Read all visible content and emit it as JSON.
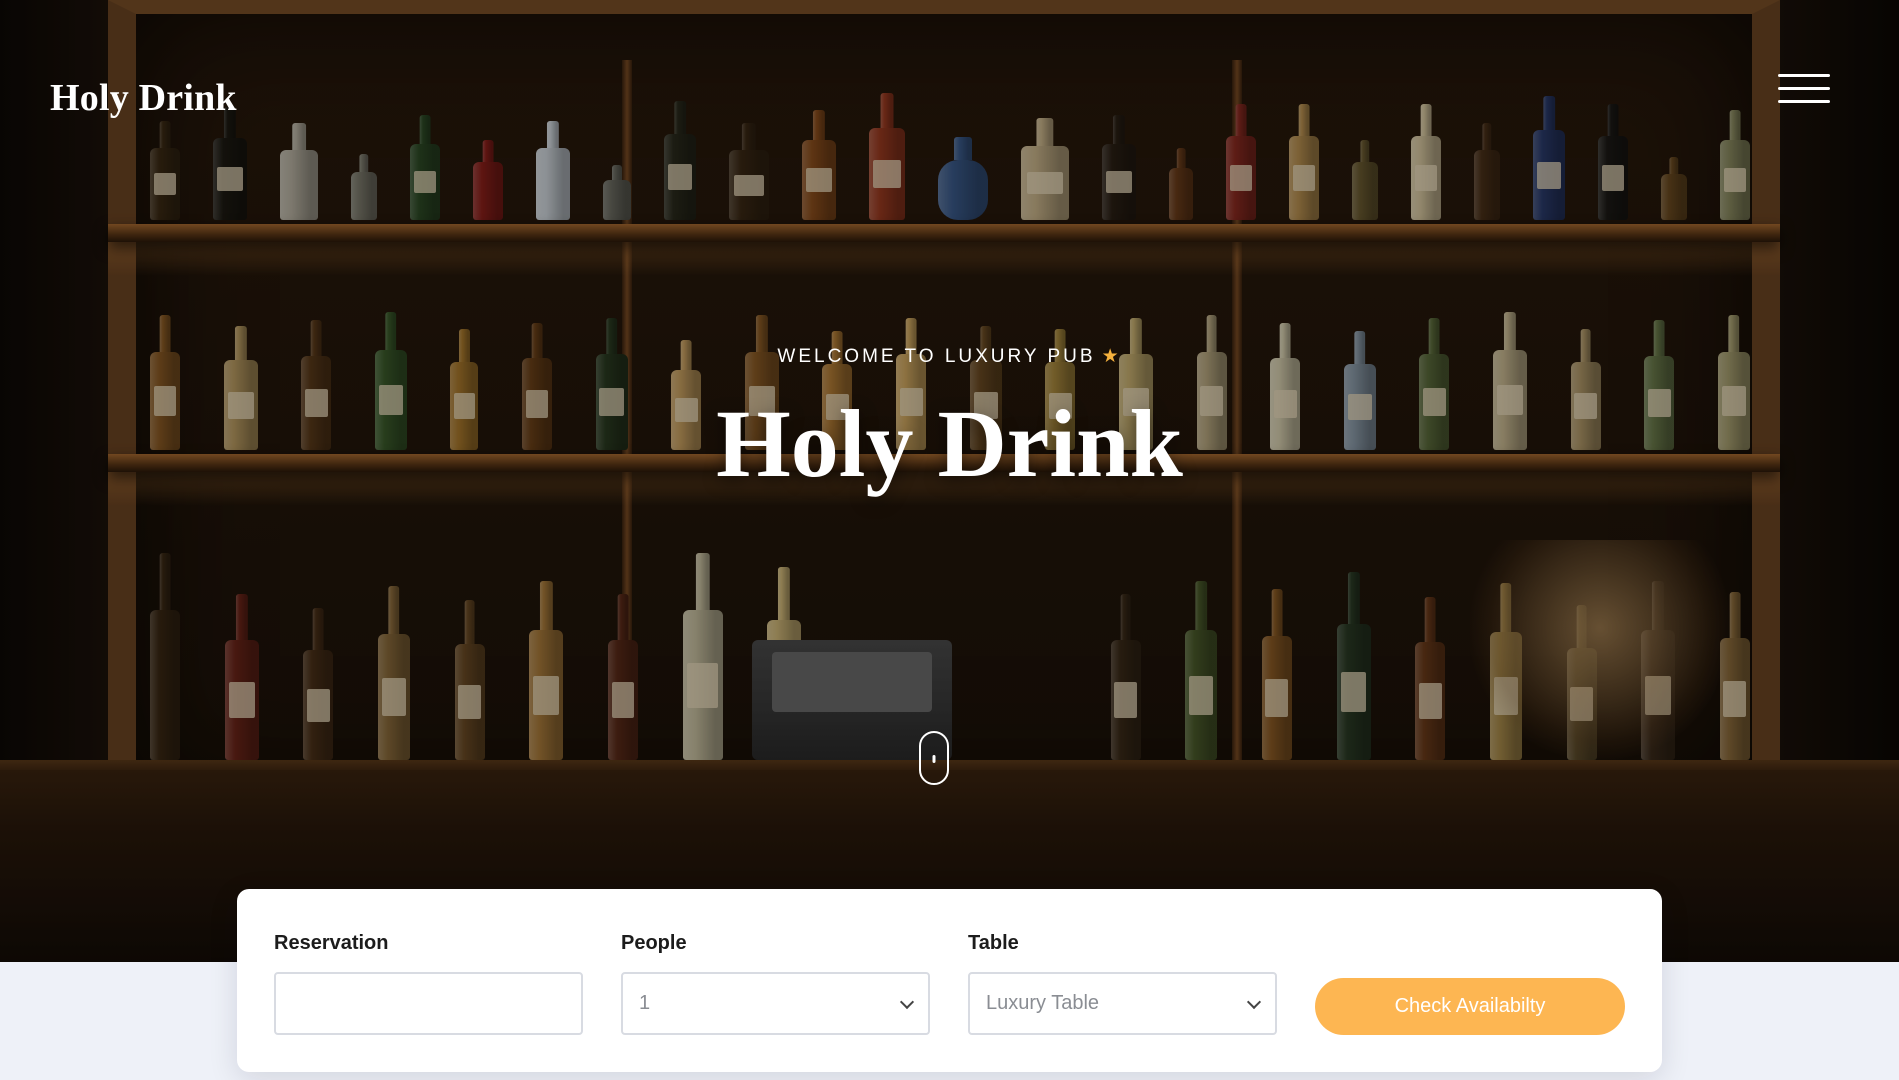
{
  "nav": {
    "brand": "Holy Drink",
    "menu_icon": "hamburger-icon"
  },
  "hero": {
    "eyebrow": "WELCOME TO LUXURY PUB",
    "eyebrow_icon": "star-icon",
    "title": "Holy Drink",
    "scroll_icon": "mouse-scroll-icon"
  },
  "booking": {
    "reservation": {
      "label": "Reservation",
      "value": ""
    },
    "people": {
      "label": "People",
      "value": "1"
    },
    "table": {
      "label": "Table",
      "value": "Luxury Table"
    },
    "button_label": "Check Availabilty"
  },
  "colors": {
    "accent": "#fdb652",
    "star": "#f5b13d",
    "page_bg": "#eef1f8",
    "card_bg": "#ffffff"
  }
}
